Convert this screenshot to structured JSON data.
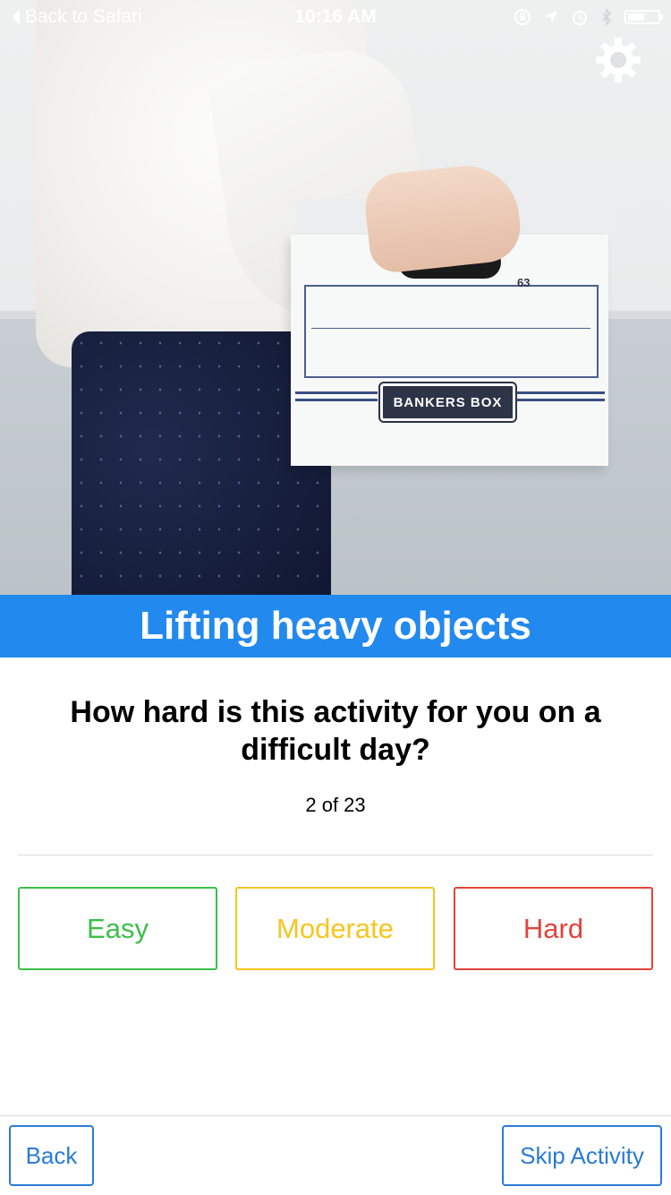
{
  "status_bar": {
    "back_label": "Back to Safari",
    "time": "10:16 AM",
    "icons": [
      "orientation-lock-icon",
      "location-icon",
      "alarm-icon",
      "bluetooth-icon",
      "battery-icon"
    ],
    "battery_level": 0.6
  },
  "hero": {
    "box_brand": "BANKERS BOX",
    "box_model": "63"
  },
  "activity": {
    "title": "Lifting heavy objects",
    "question": "How hard is this activity for you on a difficult day?",
    "progress": "2 of 23"
  },
  "answers": [
    {
      "label": "Easy",
      "color": "#3cbf4a"
    },
    {
      "label": "Moderate",
      "color": "#f7c51d"
    },
    {
      "label": "Hard",
      "color": "#e1443a"
    }
  ],
  "footer": {
    "back_label": "Back",
    "skip_label": "Skip Activity"
  },
  "colors": {
    "banner": "#2289ee",
    "nav_button": "#2a7bd6"
  }
}
